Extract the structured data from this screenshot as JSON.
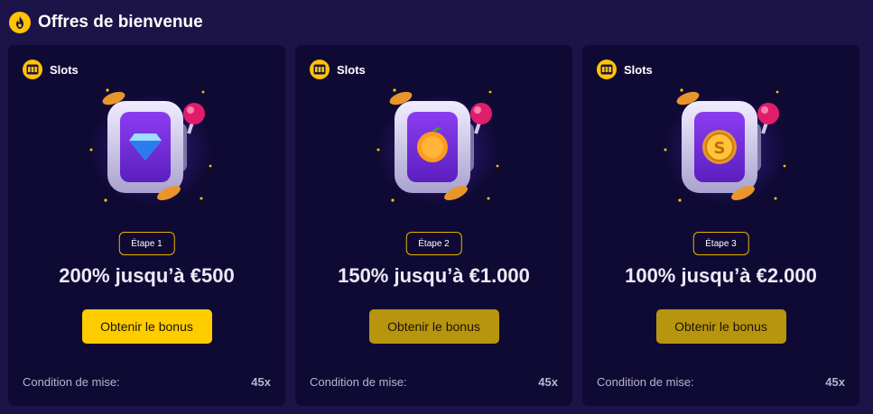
{
  "header": {
    "title": "Offres de bienvenue",
    "icon": "flame-icon",
    "accent": "#ffc400"
  },
  "cards": [
    {
      "category": "Slots",
      "category_icon": "slot-machine-icon",
      "symbol": "diamond",
      "step": "Étape 1",
      "offer": "200% jusqu’à €500",
      "button": "Obtenir le bonus",
      "button_active": true,
      "wager_label": "Condition de mise:",
      "wager_value": "45x"
    },
    {
      "category": "Slots",
      "category_icon": "slot-machine-icon",
      "symbol": "orange",
      "step": "Étape 2",
      "offer": "150% jusqu’à €1.000",
      "button": "Obtenir le bonus",
      "button_active": false,
      "wager_label": "Condition de mise:",
      "wager_value": "45x"
    },
    {
      "category": "Slots",
      "category_icon": "slot-machine-icon",
      "symbol": "coin",
      "step": "Étape 3",
      "offer": "100% jusqu’à €2.000",
      "button": "Obtenir le bonus",
      "button_active": false,
      "wager_label": "Condition de mise:",
      "wager_value": "45x"
    }
  ],
  "colors": {
    "page_bg": "#1c1348",
    "card_bg": "#0f0a34",
    "button_active": "#ffcc00",
    "button_inactive": "#b8950f",
    "pill_border": "#e8b400"
  }
}
